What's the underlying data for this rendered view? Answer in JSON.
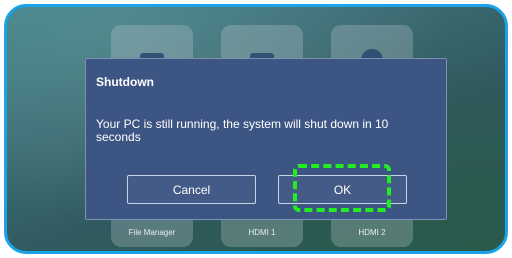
{
  "tiles": [
    {
      "label": "File Manager",
      "icon": "folder-icon"
    },
    {
      "label": "HDMI 1",
      "icon": "hdmi-icon"
    },
    {
      "label": "HDMI 2",
      "icon": "hdmi-icon"
    }
  ],
  "dialog": {
    "title": "Shutdown",
    "message": "Your PC is still running, the system will shut down in 10 seconds",
    "cancel_label": "Cancel",
    "ok_label": "OK"
  },
  "colors": {
    "frame": "#1aa3e8",
    "dialog_bg": "#3d5583",
    "focus_highlight": "#22ee22"
  }
}
